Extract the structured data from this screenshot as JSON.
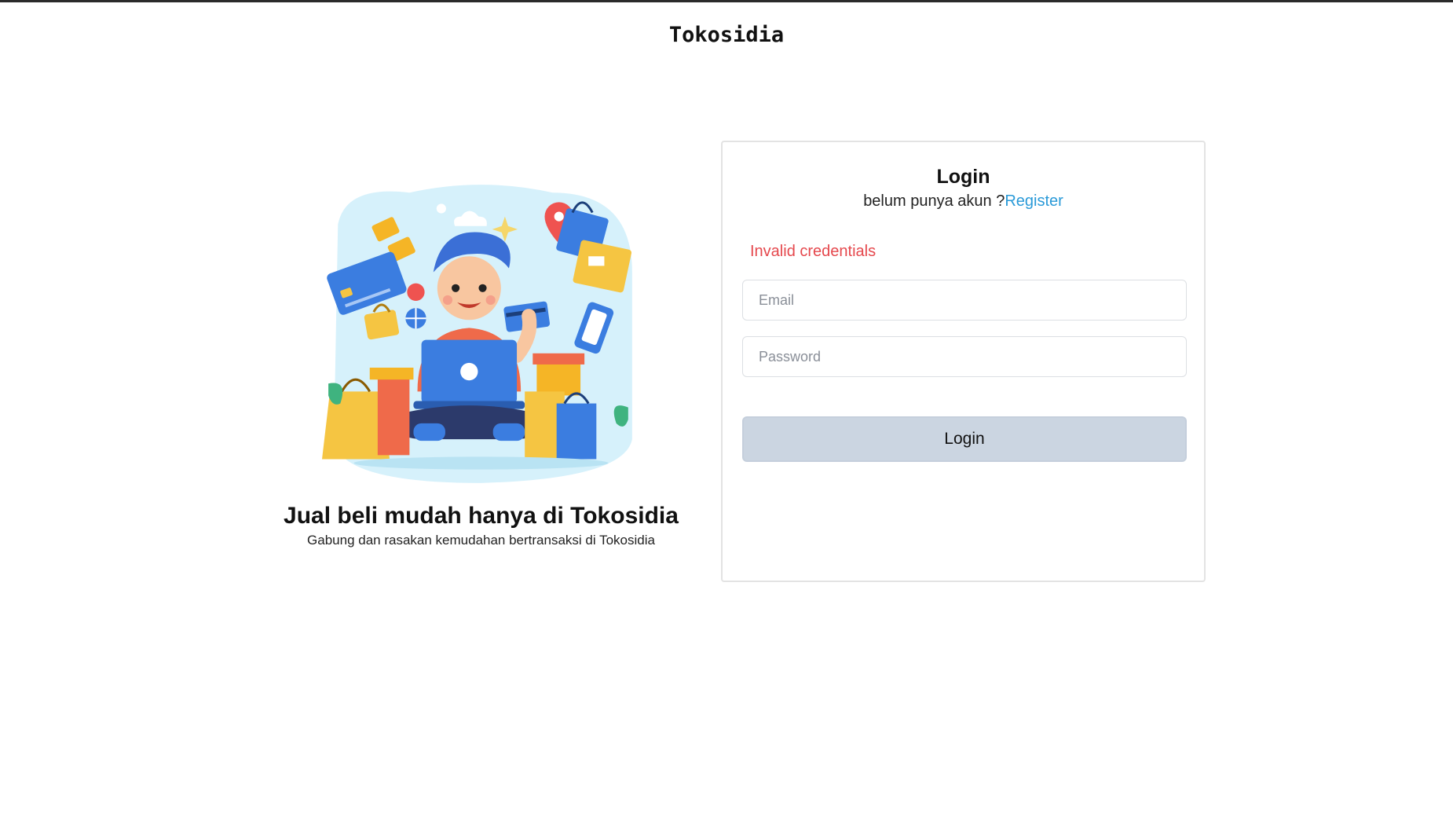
{
  "header": {
    "brand": "Tokosidia"
  },
  "hero": {
    "title": "Jual beli mudah hanya di Tokosidia",
    "subtitle": "Gabung dan rasakan kemudahan bertransaksi di Tokosidia",
    "illustration_icon": "online-shopping-illustration"
  },
  "login": {
    "title": "Login",
    "register_prompt": "belum punya akun ?",
    "register_link": "Register",
    "error": "Invalid credentials",
    "email_placeholder": "Email",
    "password_placeholder": "Password",
    "submit_label": "Login"
  },
  "colors": {
    "accent_link": "#2a9ad8",
    "error": "#e5484d",
    "button_bg": "#cbd5e1",
    "border": "#e3e3e3"
  }
}
